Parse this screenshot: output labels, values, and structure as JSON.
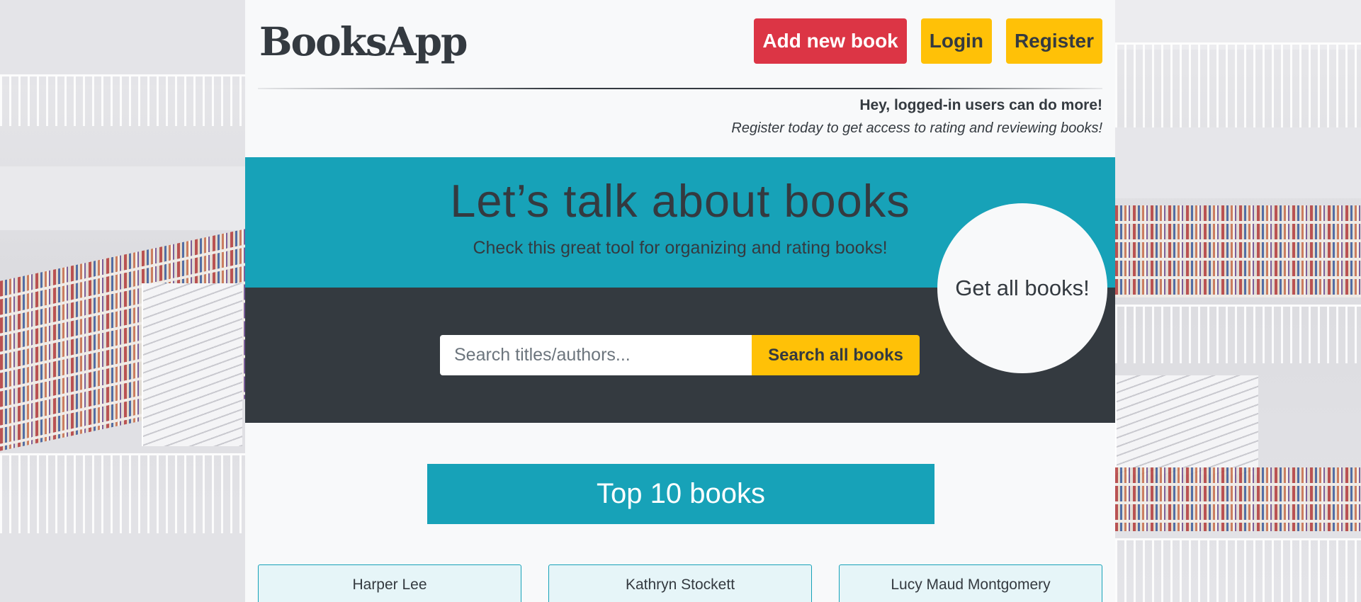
{
  "app": {
    "title": "BooksApp"
  },
  "nav": {
    "add_book": "Add new book",
    "login": "Login",
    "register": "Register"
  },
  "notice": {
    "title": "Hey, logged-in users can do more!",
    "text": "Register today to get access to rating and reviewing books!"
  },
  "hero": {
    "title": "Let’s talk about books",
    "subtitle": "Check this great tool for organizing and rating books!"
  },
  "search": {
    "placeholder": "Search titles/authors...",
    "button": "Search all books"
  },
  "get_all": "Get all books!",
  "top_books": {
    "title": "Top 10 books",
    "cards": [
      "Harper Lee",
      "Kathryn Stockett",
      "Lucy Maud Montgomery"
    ]
  },
  "colors": {
    "accent_teal": "#17a2b8",
    "danger_red": "#dc3545",
    "warning_yellow": "#ffc107",
    "dark": "#343a40",
    "light": "#f8f9fa"
  }
}
